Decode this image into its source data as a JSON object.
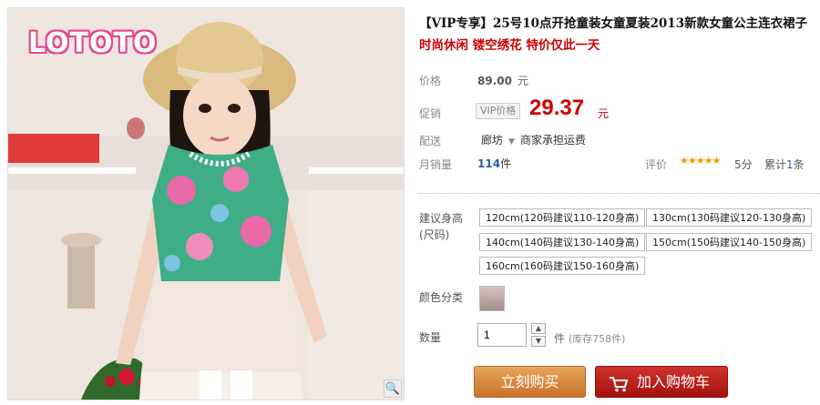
{
  "product": {
    "title": "【VIP专享】25号10点开抢童装女童夏装2013新款女童公主连衣裙子",
    "subtitle": "时尚休闲 镂空绣花 特价仅此一天",
    "logo_text": "LOTOTO"
  },
  "pricing": {
    "price_label": "价格",
    "original_price": "89.00",
    "currency_unit": "元",
    "promo_label": "促销",
    "vip_tag": "VIP价格",
    "promo_price": "29.37",
    "promo_unit": "元"
  },
  "shipping": {
    "label": "配送",
    "from": "廊坊",
    "note": "商家承担运费"
  },
  "stats": {
    "sales_label": "月销量",
    "sales_count": "114",
    "sales_unit": "件",
    "review_label": "评价",
    "stars": "★★★★★",
    "score": "5分",
    "tally_prefix": "累计",
    "tally_count": "1",
    "tally_unit": "条"
  },
  "options": {
    "size_label": "建议身高(尺码)",
    "sizes": [
      "120cm(120码建议110-120身高)",
      "130cm(130码建议120-130身高)",
      "140cm(140码建议130-140身高)",
      "150cm(150码建议140-150身高)",
      "160cm(160码建议150-160身高)"
    ],
    "color_label": "颜色分类"
  },
  "quantity": {
    "label": "数量",
    "value": "1",
    "unit": "件",
    "stock": "(库存758件)"
  },
  "actions": {
    "buy_now": "立刻购买",
    "add_to_cart": "加入购物车"
  },
  "icons": {
    "zoom": "magnifier-icon",
    "cart": "shopping-cart-icon",
    "dropdown": "chevron-down-icon"
  },
  "colors": {
    "price_red": "#c00000",
    "link_blue": "#2a5caa",
    "buy_orange": "#d98a40",
    "cart_red": "#b81f1b",
    "logo_pink": "#e4478e"
  }
}
